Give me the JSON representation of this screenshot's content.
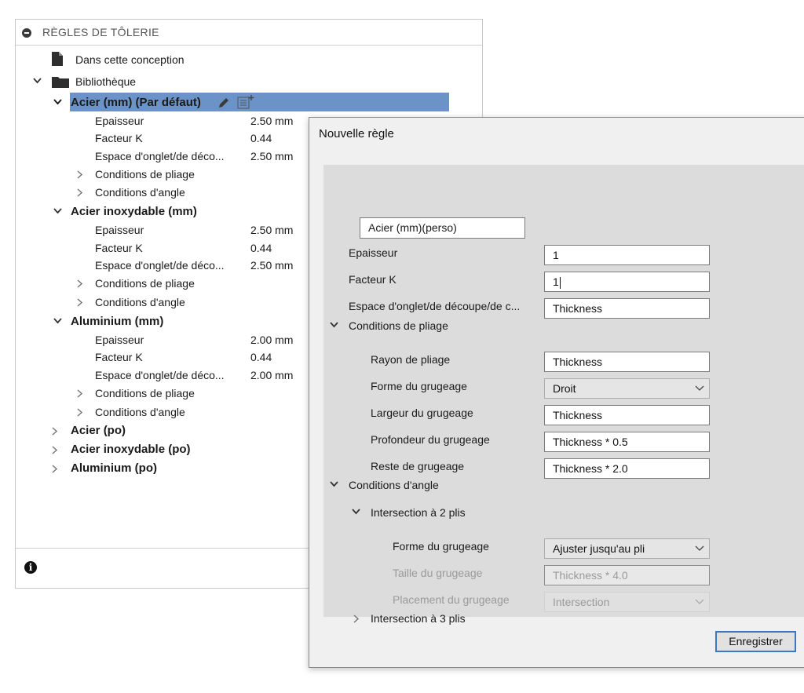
{
  "panel": {
    "title": "RÈGLES DE TÔLERIE",
    "design_item": "Dans cette conception",
    "library_label": "Bibliothèque",
    "rules": [
      {
        "name": "Acier (mm) (Par défaut)",
        "props": [
          {
            "label": "Epaisseur",
            "value": "2.50 mm"
          },
          {
            "label": "Facteur K",
            "value": "0.44"
          },
          {
            "label": "Espace d'onglet/de déco...",
            "value": "2.50 mm"
          }
        ],
        "sub": [
          "Conditions de pliage",
          "Conditions d'angle"
        ]
      },
      {
        "name": "Acier inoxydable (mm)",
        "props": [
          {
            "label": "Epaisseur",
            "value": "2.50 mm"
          },
          {
            "label": "Facteur K",
            "value": "0.44"
          },
          {
            "label": "Espace d'onglet/de déco...",
            "value": "2.50 mm"
          }
        ],
        "sub": [
          "Conditions de pliage",
          "Conditions d'angle"
        ]
      },
      {
        "name": "Aluminium (mm)",
        "props": [
          {
            "label": "Epaisseur",
            "value": "2.00 mm"
          },
          {
            "label": "Facteur K",
            "value": "0.44"
          },
          {
            "label": "Espace d'onglet/de déco...",
            "value": "2.00 mm"
          }
        ],
        "sub": [
          "Conditions de pliage",
          "Conditions d'angle"
        ]
      }
    ],
    "collapsed_rules": [
      "Acier (po)",
      "Acier inoxydable (po)",
      "Aluminium (po)"
    ],
    "info_glyph": "i"
  },
  "dialog": {
    "title": "Nouvelle règle",
    "name_value": "Acier (mm)(perso)",
    "fields": {
      "thickness_label": "Epaisseur",
      "thickness_value": "1",
      "kfactor_label": "Facteur K",
      "kfactor_value": "1",
      "gap_label": "Espace d'onglet/de découpe/de c...",
      "gap_value": "Thickness"
    },
    "bend": {
      "header": "Conditions de pliage",
      "radius_label": "Rayon de pliage",
      "radius_value": "Thickness",
      "relief_shape_label": "Forme du grugeage",
      "relief_shape_value": "Droit",
      "relief_width_label": "Largeur du grugeage",
      "relief_width_value": "Thickness",
      "relief_depth_label": "Profondeur du grugeage",
      "relief_depth_value": "Thickness * 0.5",
      "remnant_label": "Reste de grugeage",
      "remnant_value": "Thickness * 2.0"
    },
    "corner": {
      "header": "Conditions d'angle",
      "two_bend_header": "Intersection à 2 plis",
      "shape_label": "Forme du grugeage",
      "shape_value": "Ajuster jusqu'au pli",
      "size_label": "Taille du grugeage",
      "size_value": "Thickness * 4.0",
      "placement_label": "Placement du grugeage",
      "placement_value": "Intersection",
      "three_bend_header": "Intersection à 3 plis"
    },
    "save_label": "Enregistrer"
  }
}
